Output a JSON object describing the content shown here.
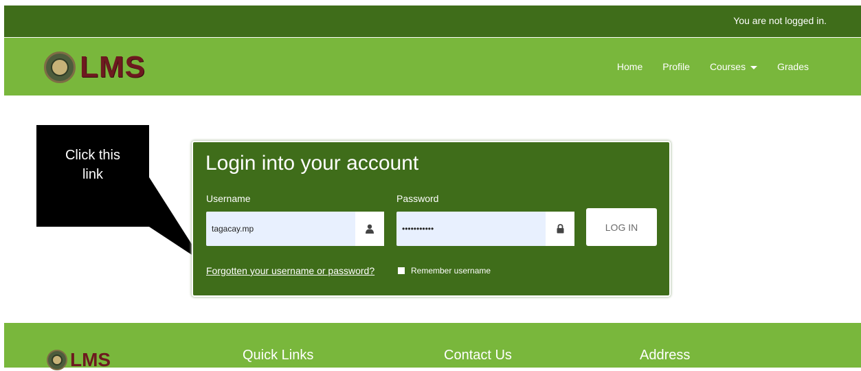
{
  "topbar": {
    "login_status": "You are not logged in."
  },
  "navbar": {
    "brand_text": "LMS",
    "links": [
      {
        "label": "Home"
      },
      {
        "label": "Profile"
      },
      {
        "label": "Courses"
      },
      {
        "label": "Grades"
      }
    ]
  },
  "annotation": {
    "line1": "Click this",
    "line2": "link"
  },
  "login": {
    "title": "Login into your account",
    "username_label": "Username",
    "username_value": "tagacay.mp",
    "password_label": "Password",
    "password_value": "•••••••••••",
    "login_button": "LOG IN",
    "forgot_link": "Forgotten your username or password?",
    "remember_label": "Remember username"
  },
  "footer": {
    "brand_text": "LMS",
    "headings": [
      "Quick Links",
      "Contact Us",
      "Address"
    ]
  },
  "colors": {
    "dark_green": "#3f6d1a",
    "light_green": "#79b73c",
    "brand_maroon": "#6d1a1f",
    "input_bg": "#e8f0fe"
  },
  "icons": [
    "user-icon",
    "lock-icon",
    "caret-down-icon"
  ]
}
